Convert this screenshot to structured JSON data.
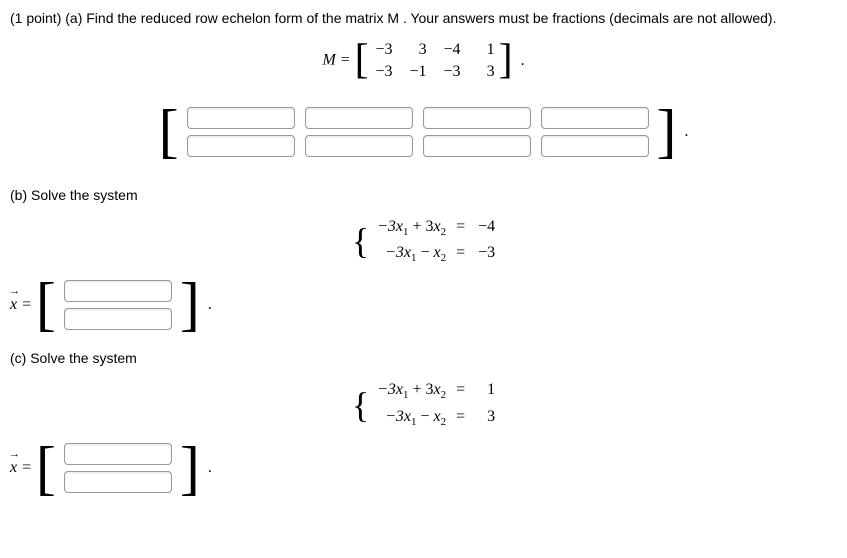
{
  "intro": "(1 point) (a) Find the reduced row echelon form of the matrix M . Your answers must be fractions (decimals are not allowed).",
  "matrixM": {
    "label": "M =",
    "r1c1": "−3",
    "r1c2": "3",
    "r1c3": "−4",
    "r1c4": "1",
    "r2c1": "−3",
    "r2c2": "−1",
    "r2c3": "−3",
    "r2c4": "3"
  },
  "partB": {
    "label": "(b) Solve the system",
    "eq1_lhs": "−3x₁ + 3x₂",
    "eq1_rhs": "−4",
    "eq2_lhs": "−3x₁ − x₂",
    "eq2_rhs": "−3",
    "eqsign": "="
  },
  "partC": {
    "label": "(c) Solve the system",
    "eq1_lhs": "−3x₁ + 3x₂",
    "eq1_rhs": "1",
    "eq2_lhs": "−3x₁ − x₂",
    "eq2_rhs": "3",
    "eqsign": "="
  },
  "vecLabel": "x ="
}
